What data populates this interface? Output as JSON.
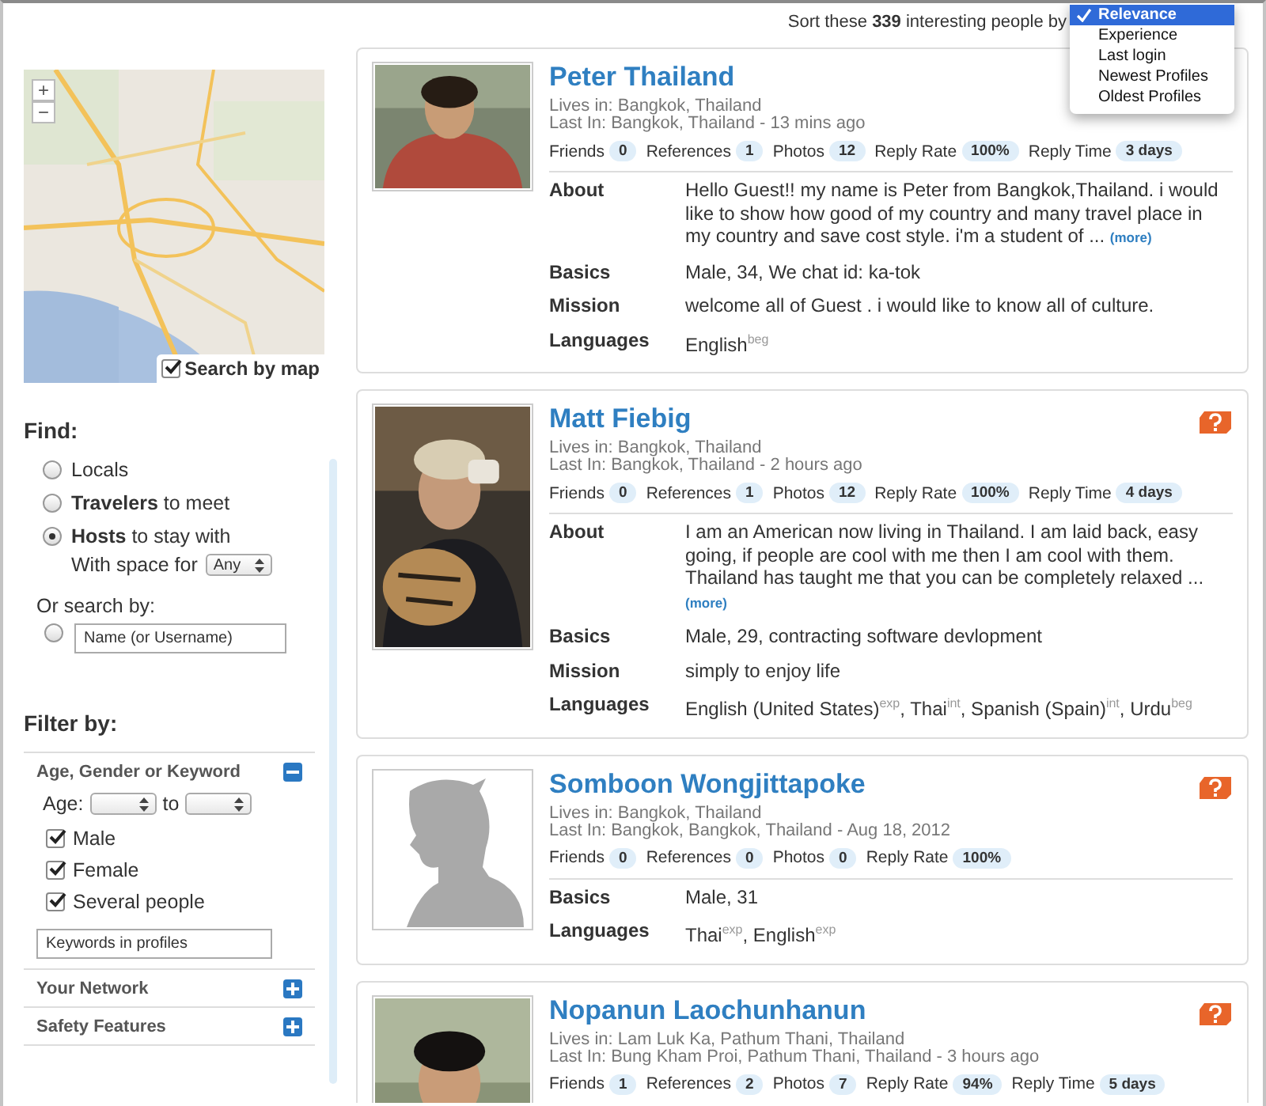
{
  "sort": {
    "text": "Sort these **339** interesting people by",
    "options": [
      {
        "label": "Relevance",
        "selected": true
      },
      {
        "label": "Experience",
        "selected": false
      },
      {
        "label": "Last login",
        "selected": false
      },
      {
        "label": "Newest Profiles",
        "selected": false
      },
      {
        "label": "Oldest Profiles",
        "selected": false
      }
    ]
  },
  "map": {
    "kind": "picture",
    "zoom": [
      "+",
      "−"
    ],
    "search_by_map": {
      "label": "Search by map",
      "checked": true
    }
  },
  "find": {
    "title": "Find:",
    "options": [
      {
        "label": "Locals",
        "selected": false
      },
      {
        "label": "**Travelers** to meet",
        "selected": false
      },
      {
        "label": "**Hosts** to stay with",
        "selected": true
      }
    ],
    "space": {
      "label": "With space for",
      "value": "Any"
    },
    "or_search": {
      "label": "Or search by:",
      "selected": false,
      "placeholder": "Name (or Username)"
    }
  },
  "filter": {
    "title": "Filter by:",
    "sections": [
      {
        "title": "Age, Gender or Keyword",
        "expanded": true,
        "age": {
          "label": "Age:",
          "to": "to"
        },
        "checkboxes": [
          {
            "label": "Male",
            "checked": true
          },
          {
            "label": "Female",
            "checked": true
          },
          {
            "label": "Several people",
            "checked": true
          }
        ],
        "keywords": {
          "placeholder": "Keywords in profiles"
        }
      },
      {
        "title": "Your Network",
        "expanded": false
      },
      {
        "title": "Safety Features",
        "expanded": false
      }
    ]
  },
  "profiles": [
    {
      "name": "Peter Thailand",
      "photo": {
        "kind": "picture"
      },
      "lives_in": {
        "label": "Lives in:",
        "value": "Bangkok, Thailand"
      },
      "last_in": {
        "label": "Last In:",
        "value": "Bangkok, Thailand - 13 mins ago"
      },
      "stats": [
        {
          "label": "Friends",
          "value": "0"
        },
        {
          "label": "References",
          "value": "1"
        },
        {
          "label": "Photos",
          "value": "12"
        },
        {
          "label": "Reply Rate",
          "value": "100%"
        },
        {
          "label": "Reply Time",
          "value": "3 days"
        }
      ],
      "details": [
        {
          "label": "About",
          "text": "Hello Guest!! my name is Peter from Bangkok,Thailand. i would like to show how good of my country and many travel place in my country and save cost style. i'm a student of ...",
          "more": "(more)"
        },
        {
          "label": "Basics",
          "text": "Male, 34, We chat id: ka-tok"
        },
        {
          "label": "Mission",
          "text": "welcome all of Guest . i would like to know all of culture."
        },
        {
          "label": "Languages",
          "text": "English$^{beg}$"
        }
      ]
    },
    {
      "name": "Matt Fiebig",
      "photo": {
        "kind": "picture"
      },
      "help_icon": true,
      "lives_in": {
        "label": "Lives in:",
        "value": "Bangkok, Thailand"
      },
      "last_in": {
        "label": "Last In:",
        "value": "Bangkok, Thailand - 2 hours ago"
      },
      "stats": [
        {
          "label": "Friends",
          "value": "0"
        },
        {
          "label": "References",
          "value": "1"
        },
        {
          "label": "Photos",
          "value": "12"
        },
        {
          "label": "Reply Rate",
          "value": "100%"
        },
        {
          "label": "Reply Time",
          "value": "4 days"
        }
      ],
      "details": [
        {
          "label": "About",
          "text": "I am an American now living in Thailand. I am laid back, easy going, if people are cool with me then I am cool with them. Thailand has taught me that you can be completely relaxed ...",
          "more": "(more)"
        },
        {
          "label": "Basics",
          "text": "Male, 29, contracting software devlopment"
        },
        {
          "label": "Mission",
          "text": "simply to enjoy life"
        },
        {
          "label": "Languages",
          "text": "English (United States)$^{exp}$, Thai$^{int}$, Spanish (Spain)$^{int}$, Urdu$^{beg}$"
        }
      ]
    },
    {
      "name": "Somboon Wongjittapoke",
      "photo": {
        "kind": "silhouette"
      },
      "help_icon": true,
      "lives_in": {
        "label": "Lives in:",
        "value": "Bangkok, Thailand"
      },
      "last_in": {
        "label": "Last In:",
        "value": "Bangkok, Bangkok, Thailand - Aug 18, 2012"
      },
      "stats": [
        {
          "label": "Friends",
          "value": "0"
        },
        {
          "label": "References",
          "value": "0"
        },
        {
          "label": "Photos",
          "value": "0"
        },
        {
          "label": "Reply Rate",
          "value": "100%"
        }
      ],
      "details": [
        {
          "label": "Basics",
          "text": "Male, 31"
        },
        {
          "label": "Languages",
          "text": "Thai$^{exp}$, English$^{exp}$"
        }
      ]
    },
    {
      "name": "Nopanun Laochunhanun",
      "photo": {
        "kind": "picture"
      },
      "help_icon": true,
      "lives_in": {
        "label": "Lives in:",
        "value": "Lam Luk Ka, Pathum Thani, Thailand"
      },
      "last_in": {
        "label": "Last In:",
        "value": "Bung Kham Proi, Pathum Thani, Thailand - 3 hours ago"
      },
      "stats": [
        {
          "label": "Friends",
          "value": "1"
        },
        {
          "label": "References",
          "value": "2"
        },
        {
          "label": "Photos",
          "value": "7"
        },
        {
          "label": "Reply Rate",
          "value": "94%"
        },
        {
          "label": "Reply Time",
          "value": "5 days"
        }
      ]
    }
  ]
}
